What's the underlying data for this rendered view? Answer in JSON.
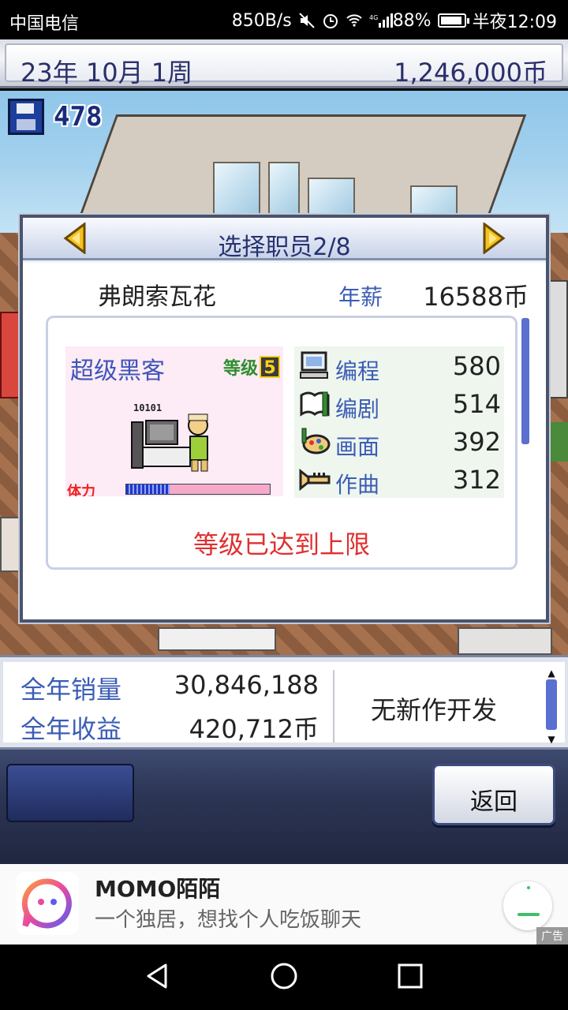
{
  "statusbar": {
    "carrier": "中国电信",
    "speed": "850B/s",
    "network": "4G",
    "battery": "88%",
    "time": "半夜12:09",
    "icons": [
      "mute-icon",
      "alarm-icon",
      "wifi-icon",
      "signal-icon",
      "battery-icon"
    ]
  },
  "topbar": {
    "date": "23年 10月 1周",
    "money": "1,246,000币"
  },
  "save": {
    "count": "478"
  },
  "dialog": {
    "title": "选择职员2/8",
    "employee_name": "弗朗索瓦花",
    "salary_label": "年薪",
    "salary_value": "16588币",
    "job_title": "超级黑客",
    "level_label": "等级",
    "level_value": "5",
    "sprite_text": "10101",
    "stamina_label": "体力",
    "stamina_fraction": 0.3,
    "stats": [
      {
        "icon": "computer-icon",
        "label": "编程",
        "value": "580"
      },
      {
        "icon": "script-icon",
        "label": "编剧",
        "value": "514"
      },
      {
        "icon": "paint-icon",
        "label": "画面",
        "value": "392"
      },
      {
        "icon": "trumpet-icon",
        "label": "作曲",
        "value": "312"
      }
    ],
    "cap_message": "等级已达到上限"
  },
  "summary": {
    "sales_label": "全年销量",
    "sales_value": "30,846,188",
    "revenue_label": "全年收益",
    "revenue_value": "420,712币",
    "dev_status": "无新作开发"
  },
  "controls": {
    "back_label": "返回"
  },
  "ad": {
    "title": "MOMO陌陌",
    "description": "一个独居，想找个人吃饭聊天",
    "badge": "广告"
  },
  "colors": {
    "accent_blue": "#3c5db5",
    "title_navy": "#26326f",
    "alert_red": "#e03030",
    "panel_pink": "#fdebf6"
  }
}
